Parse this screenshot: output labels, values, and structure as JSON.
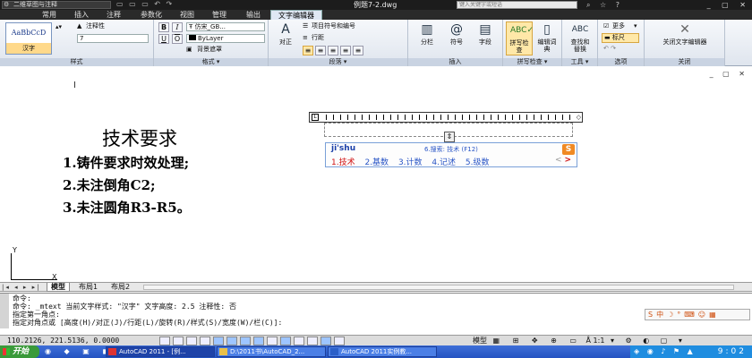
{
  "titlebar": {
    "workspace": "二维草图与注释",
    "document_title": "例题7-2.dwg",
    "search_placeholder": "键入关键字或短语"
  },
  "ribbon_tabs": [
    {
      "label": "常用"
    },
    {
      "label": "插入"
    },
    {
      "label": "注释"
    },
    {
      "label": "参数化"
    },
    {
      "label": "视图"
    },
    {
      "label": "管理"
    },
    {
      "label": "输出"
    },
    {
      "label": "文字编辑器",
      "active": true
    }
  ],
  "ribbon": {
    "style": {
      "label": "样式",
      "preview_text": "AaBbCcD",
      "style_name": "汉字",
      "annotative": "注释性",
      "height_value": "7"
    },
    "format": {
      "label": "格式",
      "bold": "B",
      "italic": "I",
      "underline": "U",
      "overline": "O",
      "font": "仿宋_GB...",
      "color": "ByLayer",
      "mask": "背景遮罩"
    },
    "paragraph": {
      "label": "段落",
      "justify": "对正",
      "bullets": "项目符号和编号",
      "line_spacing": "行距"
    },
    "insert": {
      "label": "插入",
      "columns": "分栏",
      "symbol": "符号",
      "field": "字段"
    },
    "spell": {
      "label": "拼写检查",
      "spell_check": "拼写检查",
      "edit_dict": "编辑词典"
    },
    "tools": {
      "label": "工具",
      "find_replace": "查找和替换"
    },
    "options": {
      "label": "选项",
      "more": "更多",
      "ruler": "标尺"
    },
    "close": {
      "label": "关闭",
      "close_editor": "关闭文字编辑器"
    }
  },
  "drawing": {
    "mtext_title": "技术要求",
    "mtext_lines": [
      "1.铸件要求时效处理;",
      "2.未注倒角C2;",
      "3.未注圆角R3-R5。"
    ],
    "ime": {
      "pinyin": "ji'shu",
      "hint": "6.搜索: 技术 (F12)",
      "candidates": [
        "1.技术",
        "2.基数",
        "3.计数",
        "4.记述",
        "5.级数"
      ]
    },
    "ucs": {
      "x": "X",
      "y": "Y"
    }
  },
  "layout_tabs": [
    {
      "label": "模型",
      "active": true
    },
    {
      "label": "布局1"
    },
    {
      "label": "布局2"
    }
  ],
  "command": {
    "lines": [
      "命令:",
      "命令:  _mtext  当前文字样式:  \"汉字\"  文字高度:  2.5  注释性:  否",
      "指定第一角点:",
      "指定对角点或 [高度(H)/对正(J)/行距(L)/旋转(R)/样式(S)/宽度(W)/栏(C)]:"
    ]
  },
  "status": {
    "coords": "110.2126, 221.5136, 0.0000",
    "model_label": "模型",
    "scale": "1:1"
  },
  "taskbar": {
    "start": "开始",
    "tasks": [
      {
        "label": "AutoCAD 2011 - [例..."
      },
      {
        "label": "D:\\2011书\\AutoCAD_2..."
      },
      {
        "label": "AutoCAD 2011实例教..."
      }
    ],
    "clock": "9:02"
  }
}
